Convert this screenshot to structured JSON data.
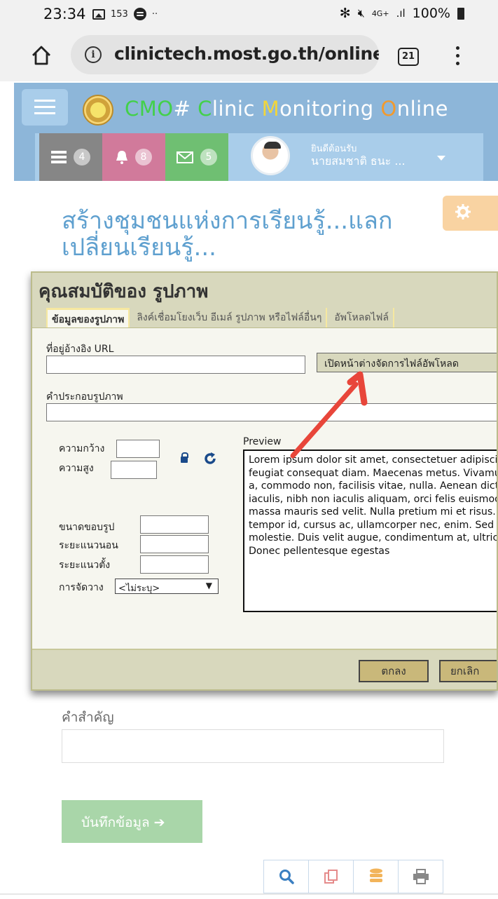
{
  "status_bar": {
    "time": "23:34",
    "notification_count": "153",
    "network": "4G+",
    "battery": "100%"
  },
  "browser": {
    "url": "clinictech.most.go.th/online",
    "tab_count": "21"
  },
  "app": {
    "title_parts": [
      "CMO",
      "# ",
      "C",
      "linic ",
      "M",
      "onitoring ",
      "O",
      "nline"
    ],
    "badges": {
      "tasks": "4",
      "alerts": "8",
      "messages": "5"
    },
    "welcome": "ยินดีต้อนรับ",
    "user_name": "นายสมชาติ ธนะ ..."
  },
  "page": {
    "heading": "สร้างชุมชนแห่งการเรียนรู้...แลกเปลี่ยนเรียนรู้..."
  },
  "dialog": {
    "title": "คุณสมบัติของ รูปภาพ",
    "tabs": [
      "ข้อมูลของรูปภาพ",
      "ลิงค์เชื่อมโยงเว็บ อีเมล์ รูปภาพ หรือไฟล์อื่นๆ",
      "อัพโหลดไฟล์"
    ],
    "url_label": "ที่อยู่อ้างอิง URL",
    "url_value": "",
    "browse_button": "เปิดหน้าต่างจัดการไฟล์อัพโหลด",
    "alt_label": "คำประกอบรูปภาพ",
    "width_label": "ความกว้าง",
    "height_label": "ความสูง",
    "border_label": "ขนาดขอบรูป",
    "hspace_label": "ระยะแนวนอน",
    "vspace_label": "ระยะแนวตั้ง",
    "align_label": "การจัดวาง",
    "align_value": "<ไม่ระบุ>",
    "preview_label": "Preview",
    "preview_text": "Lorem ipsum dolor sit amet, consectetuer adipiscing elit. Maecenas feugiat consequat diam. Maecenas metus. Vivamus diam purus, cursus a, commodo non, facilisis vitae, nulla. Aenean dictum lacinia tortor. Nunc iaculis, nibh non iaculis aliquam, orci felis euismod neque, sed ornare massa mauris sed velit. Nulla pretium mi et risus. Fusce mi pede, tempor id, cursus ac, ullamcorper nec, enim. Sed tortor. Curabitur molestie. Duis velit augue, condimentum at, ultrices a, luctus ut, orci. Donec pellentesque egestas",
    "ok_button": "ตกลง",
    "cancel_button": "ยกเลิก"
  },
  "form": {
    "keywords_label": "คำสำคัญ",
    "keywords_value": "",
    "save_button": "บันทึกข้อมูล ➔"
  },
  "colors": {
    "header_blue": "#8db6d9",
    "heading_blue": "#5fa0cf",
    "dialog_bg": "#d8d8bd",
    "annotation_red": "#e8463a",
    "save_green": "#a9d6a9"
  },
  "icons": [
    "home-icon",
    "info-icon",
    "tabs-icon",
    "menu-icon",
    "hamburger-icon",
    "tasks-icon",
    "bell-icon",
    "mail-icon",
    "gear-icon",
    "lock-icon",
    "refresh-icon",
    "search-icon",
    "copy-icon",
    "database-icon",
    "print-icon"
  ]
}
